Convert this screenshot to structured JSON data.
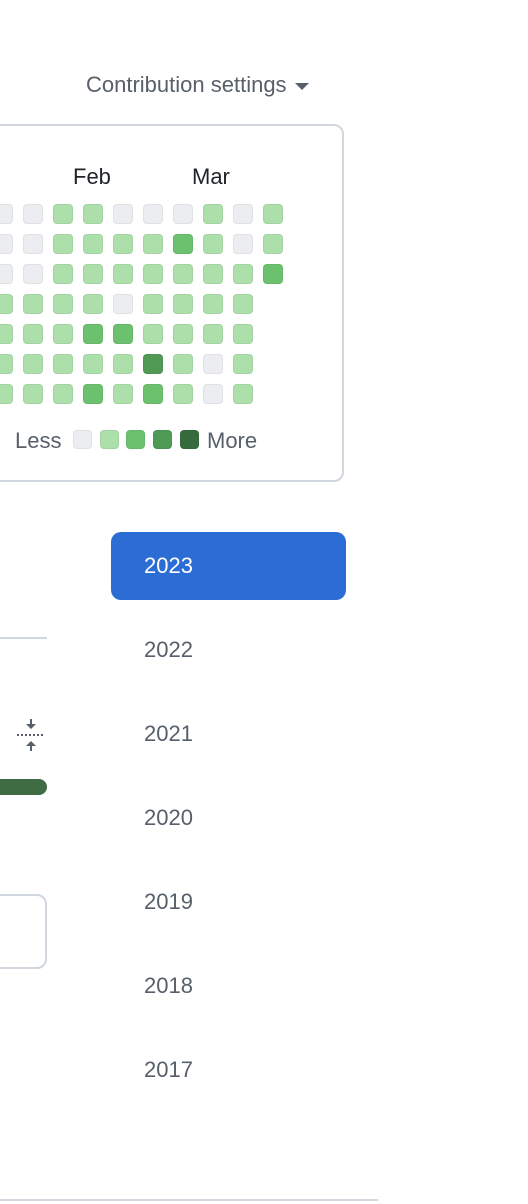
{
  "header": {
    "settings_label": "Contribution settings"
  },
  "graph": {
    "months": [
      "Feb",
      "Mar"
    ],
    "legend": {
      "less": "Less",
      "more": "More",
      "levels": [
        0,
        1,
        2,
        3,
        4
      ]
    },
    "colors": [
      "#ebedf0",
      "#acdfaa",
      "#6cc16f",
      "#4f9a55",
      "#366b3d"
    ],
    "weeks": [
      [
        0,
        0,
        0,
        1,
        1,
        1,
        1
      ],
      [
        0,
        0,
        0,
        1,
        1,
        1,
        1
      ],
      [
        1,
        1,
        1,
        1,
        1,
        1,
        1
      ],
      [
        1,
        1,
        1,
        1,
        2,
        1,
        2
      ],
      [
        0,
        1,
        1,
        0,
        2,
        1,
        1
      ],
      [
        0,
        1,
        1,
        1,
        1,
        3,
        2
      ],
      [
        0,
        2,
        1,
        1,
        1,
        1,
        1
      ],
      [
        1,
        1,
        1,
        1,
        1,
        0,
        0
      ],
      [
        0,
        0,
        1,
        1,
        1,
        1,
        1
      ],
      [
        1,
        1,
        2,
        null,
        null,
        null,
        null
      ]
    ]
  },
  "years": {
    "selected": "2023",
    "items": [
      "2023",
      "2022",
      "2021",
      "2020",
      "2019",
      "2018",
      "2017"
    ]
  }
}
